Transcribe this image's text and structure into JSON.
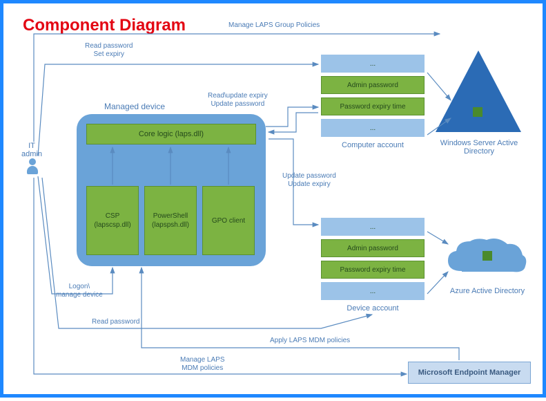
{
  "title": "Component Diagram",
  "it_admin": {
    "label": "IT\nadmin"
  },
  "managed_device": {
    "label": "Managed device",
    "core_logic": "Core logic (laps.dll)",
    "csp": "CSP\n(lapscsp.dll)",
    "powershell": "PowerShell\n(lapspsh.dll)",
    "gpo": "GPO client"
  },
  "computer_account": {
    "label": "Computer account",
    "rows": [
      "...",
      "Admin password",
      "Password expiry time",
      "..."
    ]
  },
  "device_account": {
    "label": "Device account",
    "rows": [
      "...",
      "Admin password",
      "Password expiry time",
      "..."
    ]
  },
  "windows_ad": {
    "label": "Windows Server Active Directory"
  },
  "azure_ad": {
    "label": "Azure Active Directory"
  },
  "endpoint": {
    "label": "Microsoft Endpoint Manager"
  },
  "flows": {
    "manage_policies": "Manage LAPS Group Policies",
    "read_set": "Read password\nSet expiry",
    "read_update": "Read\\update expiry\nUpdate password",
    "update_pw": "Update password\nUpdate expiry",
    "logon": "Logon\\\nmanage device",
    "read_pw": "Read password",
    "apply_mdm": "Apply LAPS MDM policies",
    "manage_mdm": "Manage LAPS\nMDM policies"
  }
}
